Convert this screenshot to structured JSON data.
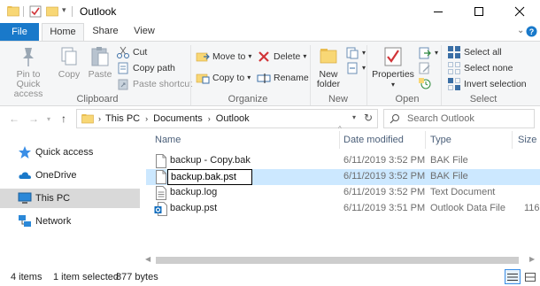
{
  "window": {
    "title": "Outlook",
    "controls": [
      "minimize",
      "maximize",
      "close"
    ]
  },
  "ribbon_tabs": [
    {
      "label": "File"
    },
    {
      "label": "Home"
    },
    {
      "label": "Share"
    },
    {
      "label": "View"
    }
  ],
  "ribbon": {
    "clipboard": {
      "label": "Clipboard",
      "pin_label": "Pin to Quick access",
      "pin_label_1": "Pin to Quick",
      "pin_label_2": "access",
      "copy": "Copy",
      "paste": "Paste",
      "cut": "Cut",
      "copy_path": "Copy path",
      "paste_shortcut": "Paste shortcut"
    },
    "organize": {
      "label": "Organize",
      "move_to": "Move to",
      "copy_to": "Copy to",
      "delete": "Delete",
      "rename": "Rename"
    },
    "new": {
      "label": "New",
      "new_folder_1": "New",
      "new_folder_2": "folder"
    },
    "open": {
      "label": "Open",
      "properties": "Properties"
    },
    "select": {
      "label": "Select",
      "select_all": "Select all",
      "select_none": "Select none",
      "invert_selection": "Invert selection"
    }
  },
  "address_bar": {
    "breadcrumb": [
      "This PC",
      "Documents",
      "Outlook"
    ],
    "search_placeholder": "Search Outlook"
  },
  "nav_pane": [
    {
      "label": "Quick access",
      "icon": "star-icon"
    },
    {
      "label": "OneDrive",
      "icon": "cloud-icon"
    },
    {
      "label": "This PC",
      "icon": "computer-icon",
      "selected": true
    },
    {
      "label": "Network",
      "icon": "network-icon"
    }
  ],
  "columns": [
    "Name",
    "Date modified",
    "Type",
    "Size"
  ],
  "files": [
    {
      "name": "backup - Copy.bak",
      "date": "6/11/2019 3:52 PM",
      "type": "BAK File",
      "size": "",
      "icon": "file-icon"
    },
    {
      "name": "backup.bak.pst",
      "date": "6/11/2019 3:52 PM",
      "type": "BAK File",
      "size": "",
      "icon": "file-icon",
      "selected": true,
      "renaming": true
    },
    {
      "name": "backup.log",
      "date": "6/11/2019 3:52 PM",
      "type": "Text Document",
      "size": "",
      "icon": "text-file-icon"
    },
    {
      "name": "backup.pst",
      "date": "6/11/2019 3:51 PM",
      "type": "Outlook Data File",
      "size": "116,",
      "icon": "outlook-file-icon"
    }
  ],
  "status": {
    "items": "4 items",
    "selected": "1 item selected",
    "size": "877 bytes"
  },
  "colors": {
    "accent": "#1979ca",
    "selection": "#cce8ff",
    "nav_selected": "#d9d9d9",
    "folder": "#f8d775"
  }
}
